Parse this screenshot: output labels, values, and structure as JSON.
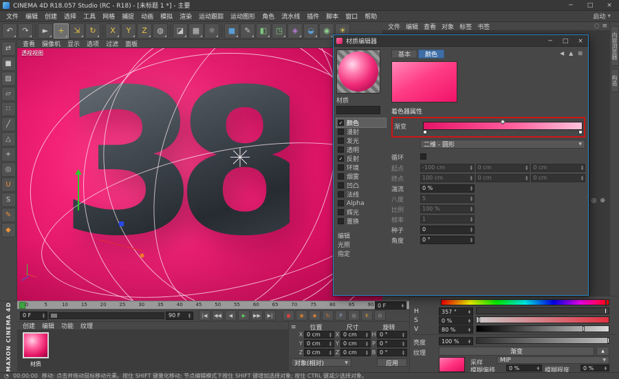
{
  "window": {
    "title": "CINEMA 4D R18.057 Studio (RC - R18) - [未标题 1 *] - 主要",
    "controls": [
      {
        "name": "minimize-button",
        "glyph": "─"
      },
      {
        "name": "maximize-button",
        "glyph": "□"
      },
      {
        "name": "close-button",
        "glyph": "×"
      }
    ]
  },
  "menu_bar": {
    "items": [
      "文件",
      "编辑",
      "创建",
      "选择",
      "工具",
      "网格",
      "捕捉",
      "动画",
      "模拟",
      "渲染",
      "运动跟踪",
      "运动图形",
      "角色",
      "流水线",
      "插件",
      "脚本",
      "窗口",
      "帮助"
    ],
    "layout_dropdown": "启动"
  },
  "toolbar": {
    "buttons": [
      {
        "name": "undo-button",
        "glyph": "↶"
      },
      {
        "name": "redo-button",
        "glyph": "↷"
      },
      {
        "divider": true
      },
      {
        "name": "live-selection-button",
        "glyph": "►"
      },
      {
        "name": "move-button",
        "glyph": "+",
        "color": "#e8c24a",
        "active": true
      },
      {
        "name": "scale-button",
        "glyph": "⇲",
        "color": "#e8c24a"
      },
      {
        "name": "rotate-button",
        "glyph": "↻",
        "color": "#e8c24a"
      },
      {
        "divider": true
      },
      {
        "name": "x-axis-lock-button",
        "glyph": "X",
        "color": "#e8c24a"
      },
      {
        "name": "y-axis-lock-button",
        "glyph": "Y",
        "color": "#e8c24a"
      },
      {
        "name": "z-axis-lock-button",
        "glyph": "Z",
        "color": "#e8c24a"
      },
      {
        "name": "coordinate-system-button",
        "glyph": "◍"
      },
      {
        "divider": true
      },
      {
        "name": "render-view-button",
        "glyph": "◪"
      },
      {
        "name": "render-picture-viewer-button",
        "glyph": "▦"
      },
      {
        "name": "render-settings-button",
        "glyph": "☼"
      },
      {
        "divider": true
      },
      {
        "name": "add-cube-button",
        "glyph": "■",
        "color": "#5a9bd4"
      },
      {
        "name": "add-spline-button",
        "glyph": "✎"
      },
      {
        "name": "add-generator-button",
        "glyph": "◧",
        "color": "#7ec87e"
      },
      {
        "name": "add-mograph-button",
        "glyph": "◳",
        "color": "#7ec87e"
      },
      {
        "name": "add-deformer-button",
        "glyph": "◈",
        "color": "#b07ad0"
      },
      {
        "name": "add-scene-object-button",
        "glyph": "◒",
        "color": "#5a9bd4"
      },
      {
        "name": "add-camera-button",
        "glyph": "◉",
        "color": "#8fd08f"
      },
      {
        "name": "add-light-button",
        "glyph": "☀",
        "color": "#e8d05a"
      }
    ]
  },
  "left_toolbar": {
    "buttons": [
      {
        "name": "make-editable-button",
        "glyph": "⇄"
      },
      {
        "name": "model-mode-button",
        "glyph": "■"
      },
      {
        "name": "texture-mode-button",
        "glyph": "▨"
      },
      {
        "name": "workplane-mode-button",
        "glyph": "▱"
      },
      {
        "name": "points-mode-button",
        "glyph": "∷"
      },
      {
        "name": "edges-mode-button",
        "glyph": "╱"
      },
      {
        "name": "polygons-mode-button",
        "glyph": "△"
      },
      {
        "name": "enable-axis-button",
        "glyph": "+"
      },
      {
        "name": "viewport-solo-button",
        "glyph": "◎"
      },
      {
        "name": "snap-button",
        "glyph": "U",
        "color": "#e8923a"
      },
      {
        "name": "workplane-lock-button",
        "glyph": "S"
      },
      {
        "name": "brush-button",
        "glyph": "✎",
        "color": "#e8923a"
      },
      {
        "name": "magnet-button",
        "glyph": "◆",
        "color": "#e8923a"
      }
    ]
  },
  "viewport": {
    "menus": [
      "查看",
      "摄像机",
      "显示",
      "选项",
      "过滤",
      "面板"
    ],
    "label": "透视视图",
    "object_text": "38"
  },
  "object_manager": {
    "menus": [
      "文件",
      "编辑",
      "查看",
      "对象",
      "标签",
      "书签"
    ],
    "icons": [
      {
        "name": "search-icon",
        "glyph": "◌"
      },
      {
        "name": "filter-icon",
        "glyph": "≡"
      }
    ],
    "attribute_icons": [
      {
        "name": "focus-icon",
        "glyph": "◎"
      },
      {
        "name": "lock-icon",
        "glyph": "⊕"
      }
    ]
  },
  "right_tabs": [
    {
      "label": "内容浏览器"
    },
    {
      "label": "构造"
    }
  ],
  "material_editor": {
    "title": "材质编辑器",
    "controls": [
      {
        "name": "me-minimize-button",
        "glyph": "─"
      },
      {
        "name": "me-maximize-button",
        "glyph": "□"
      },
      {
        "name": "me-close-button",
        "glyph": "×"
      }
    ],
    "util_icons": [
      {
        "name": "back-arrow-icon",
        "glyph": "◀"
      },
      {
        "name": "up-arrow-icon",
        "glyph": "▲"
      },
      {
        "name": "pin-icon",
        "glyph": "⊞"
      }
    ],
    "preview_label": "材质",
    "tabs": [
      {
        "label": "基本",
        "active": false
      },
      {
        "label": "颜色",
        "active": true
      }
    ],
    "channels": [
      {
        "label": "颜色",
        "checked": true,
        "selected": true
      },
      {
        "label": "漫射",
        "checked": false
      },
      {
        "label": "发光",
        "checked": false
      },
      {
        "label": "透明",
        "checked": false
      },
      {
        "label": "反射",
        "checked": true
      },
      {
        "label": "环境",
        "checked": false
      },
      {
        "label": "烟雾",
        "checked": false
      },
      {
        "label": "凹凸",
        "checked": false
      },
      {
        "label": "法线",
        "checked": false
      },
      {
        "label": "Alpha",
        "checked": false
      },
      {
        "label": "辉光",
        "checked": false
      },
      {
        "label": "置换",
        "checked": false
      }
    ],
    "footer_items": [
      "编辑",
      "光照",
      "指定"
    ],
    "section_title": "着色器属性",
    "gradient_label": "渐变",
    "type_value": "二维 - 圆形",
    "cycle_label": "循环",
    "cycle_checked": false,
    "params": [
      {
        "label": "起点",
        "values": [
          "-100 cm",
          "0 cm",
          "0 cm"
        ],
        "disabled": true
      },
      {
        "label": "终点",
        "values": [
          "100 cm",
          "0 cm",
          "0 cm"
        ],
        "disabled": true
      },
      {
        "label": "湍流",
        "values": [
          "0 %"
        ],
        "disabled": false
      },
      {
        "label": "八度",
        "values": [
          "5"
        ],
        "disabled": true
      },
      {
        "label": "比例",
        "values": [
          "100 %"
        ],
        "disabled": true
      },
      {
        "label": "频率",
        "values": [
          "1"
        ],
        "disabled": true
      },
      {
        "label": "种子",
        "values": [
          "0"
        ],
        "disabled": false
      },
      {
        "label": "角度",
        "values": [
          "0 °"
        ],
        "disabled": false
      }
    ]
  },
  "timeline": {
    "ticks": [
      0,
      5,
      10,
      15,
      20,
      25,
      30,
      35,
      40,
      45,
      50,
      55,
      60,
      65,
      70,
      75,
      80,
      85,
      90
    ],
    "current_frame": "0 F",
    "range_start": "0 F",
    "range_end": "90 F",
    "transport": [
      {
        "name": "goto-start-button",
        "glyph": "|◀"
      },
      {
        "name": "prev-key-button",
        "glyph": "◀◀"
      },
      {
        "name": "prev-frame-button",
        "glyph": "◀"
      },
      {
        "name": "play-button",
        "glyph": "▶",
        "color": "#5ec95e"
      },
      {
        "name": "next-frame-button",
        "glyph": "▶▶"
      },
      {
        "name": "goto-end-button",
        "glyph": "▶|"
      }
    ],
    "record": [
      {
        "name": "record-button",
        "glyph": "●",
        "color": "#d64040"
      },
      {
        "name": "record-position-button",
        "glyph": "◉",
        "color": "#e08030"
      },
      {
        "name": "record-scale-button",
        "glyph": "◆",
        "color": "#e08030"
      },
      {
        "name": "record-rotation-button",
        "glyph": "↻",
        "color": "#e08030"
      },
      {
        "name": "record-parameter-button",
        "glyph": "P",
        "color": "#8fa0d0"
      },
      {
        "name": "record-pla-button",
        "glyph": "◎",
        "color": "#aaaaaa"
      },
      {
        "name": "autokey-button",
        "glyph": "K",
        "color": "#e0a030"
      },
      {
        "name": "keyframe-selection-button",
        "glyph": "⊙",
        "color": "#aaaaaa"
      }
    ]
  },
  "material_manager": {
    "menus": [
      "创建",
      "编辑",
      "功能",
      "纹理"
    ],
    "materials": [
      {
        "name": "材质"
      }
    ]
  },
  "coordinates": {
    "icon": "≡",
    "columns": [
      "位置",
      "尺寸",
      "旋转"
    ],
    "rows": [
      {
        "cells": [
          {
            "axis": "X",
            "value": "0 cm"
          },
          {
            "axis": "X",
            "value": "0 cm"
          },
          {
            "axis": "H",
            "value": "0 °"
          }
        ]
      },
      {
        "cells": [
          {
            "axis": "Y",
            "value": "0 cm"
          },
          {
            "axis": "Y",
            "value": "0 cm"
          },
          {
            "axis": "P",
            "value": "0 °"
          }
        ]
      },
      {
        "cells": [
          {
            "axis": "Z",
            "value": "0 cm"
          },
          {
            "axis": "Z",
            "value": "0 cm"
          },
          {
            "axis": "B",
            "value": "0 °"
          }
        ]
      }
    ],
    "mode": "对象(相对)",
    "apply_label": "应用"
  },
  "attributes": {
    "hue": {
      "label": "H",
      "value": "357 °",
      "handle_pct": 99
    },
    "saturation": {
      "label": "S",
      "value": "0 %",
      "handle_pct": 1
    },
    "value": {
      "label": "V",
      "value": "80 %",
      "handle_pct": 80
    },
    "brightness": {
      "label": "亮度",
      "value": "100 %",
      "handle_pct": 100
    },
    "texture": {
      "label": "纹理",
      "button": "渐变"
    },
    "sampling": {
      "label": "采样",
      "value": "MIP"
    },
    "blur_offset": {
      "label": "模糊偏移",
      "value": "0 %"
    },
    "blur_scale": {
      "label": "模糊程度",
      "value": "0 %"
    }
  },
  "status_bar": {
    "time": "00:00:00",
    "message": "移动: 点击并拖动鼠标移动元素。按住 SHIFT 键量化移动; 节点编辑模式下按住 SHIFT 键增加选择对象; 按住 CTRL 键减少选择对象。"
  },
  "colors": {
    "viewport_pink": "#f32277",
    "material_pink": "#ff2e7d",
    "accent_blue": "#3f6ea6",
    "annotation_red": "#cf1515",
    "charcoal_text": "#3a4046"
  }
}
